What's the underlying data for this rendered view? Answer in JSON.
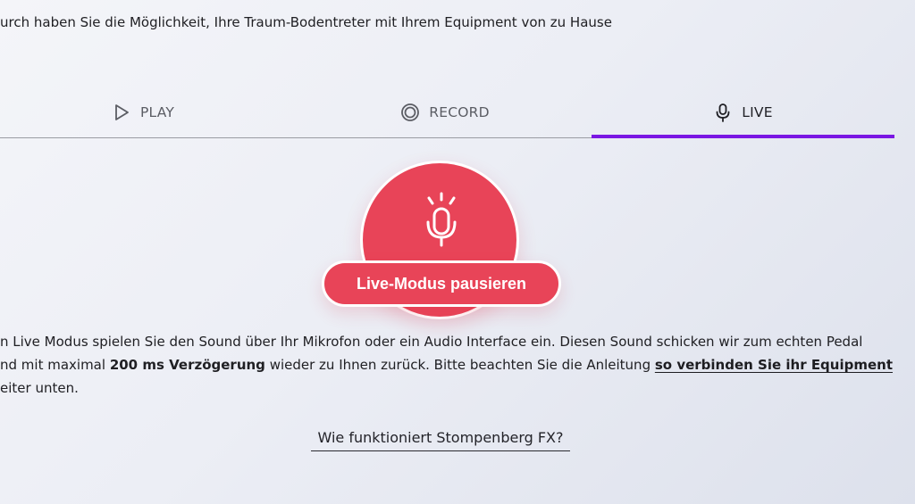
{
  "intro": {
    "text": "urch haben Sie die Möglichkeit, Ihre Traum-Bodentreter mit Ihrem Equipment von zu Hause"
  },
  "tabs": [
    {
      "label": "PLAY",
      "icon": "play-icon"
    },
    {
      "label": "RECORD",
      "icon": "record-icon"
    },
    {
      "label": "LIVE",
      "icon": "microphone-icon",
      "active": true
    }
  ],
  "live_mode": {
    "button_label": "Live-Modus pausieren",
    "icon": "microphone-icon",
    "color": "#e84458"
  },
  "description": {
    "line1": "n Live Modus spielen Sie den Sound über Ihr Mikrofon oder ein Audio Interface ein. Diesen Sound schicken wir zum echten Pedal",
    "line2_prefix": "nd mit maximal ",
    "line2_bold": "200 ms Verzögerung",
    "line2_middle": " wieder zu Ihnen zurück. Bitte beachten Sie die Anleitung ",
    "line2_link": "so verbinden Sie ihr Equipment",
    "line3": "eiter unten."
  },
  "footer_link": {
    "label": "Wie funktioniert Stompenberg FX?"
  },
  "colors": {
    "accent": "#7a16e3",
    "live": "#e84458"
  }
}
